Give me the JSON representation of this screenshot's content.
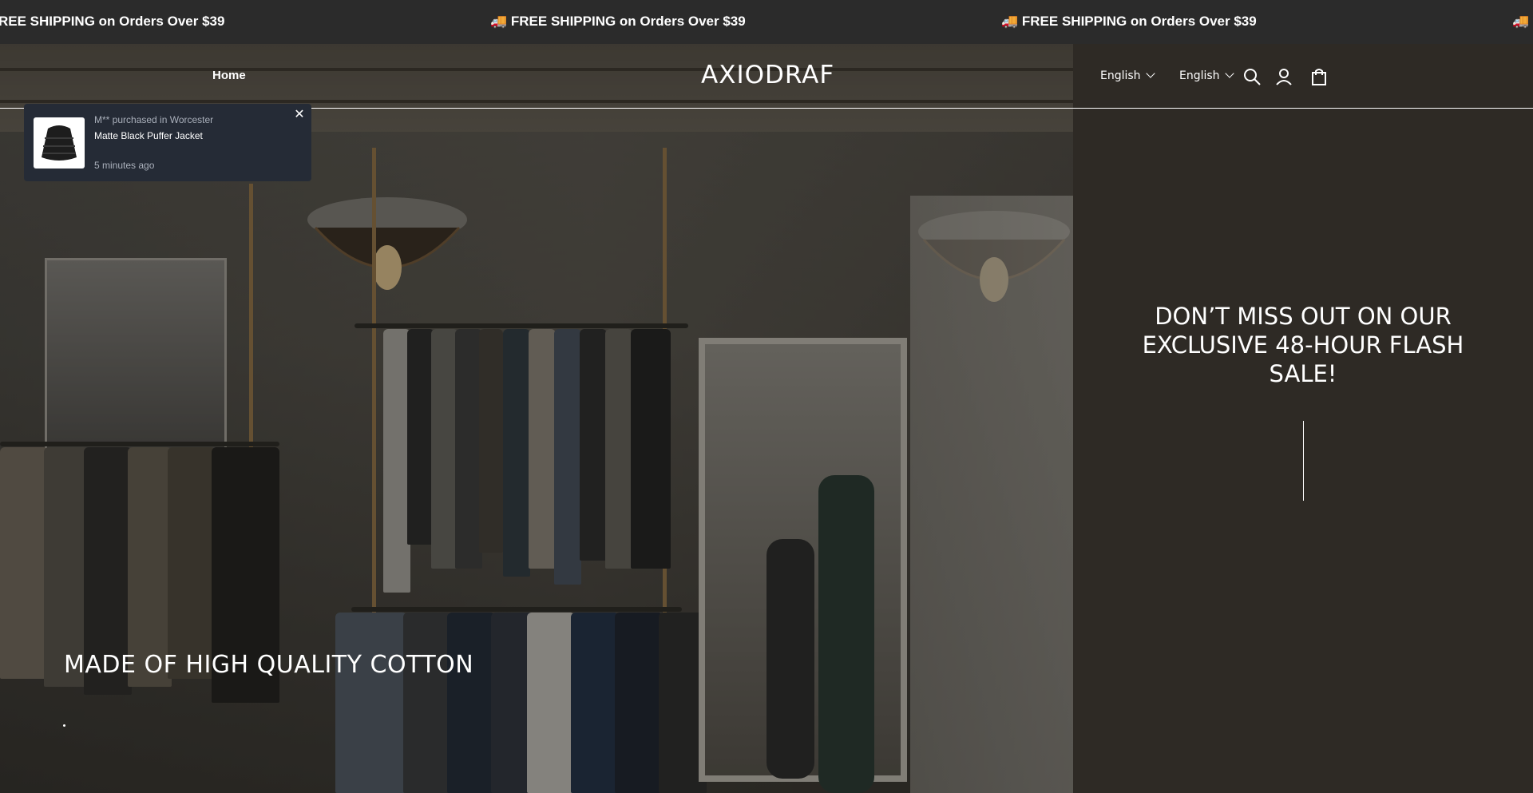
{
  "announcement": {
    "messages": [
      "REE SHIPPING on Orders Over $39",
      "🚚 FREE SHIPPING on Orders Over $39",
      "🚚 FREE SHIPPING on Orders Over $39",
      "🚚 FR"
    ]
  },
  "header": {
    "nav_home": "Home",
    "logo": "AXIODRAF",
    "language_1": "English",
    "language_2": "English",
    "icons": [
      "search-icon",
      "account-icon",
      "cart-icon"
    ]
  },
  "popup": {
    "line1": "M** purchased in Worcester",
    "line2": "Matte Black Puffer Jacket",
    "line3": "5 minutes ago",
    "close_icon": "close-icon"
  },
  "hero": {
    "caption": "MADE OF HIGH QUALITY COTTON"
  },
  "flash": {
    "heading": "DON’T MISS OUT ON OUR EXCLUSIVE 48-HOUR FLASH SALE!"
  },
  "colors": {
    "announcement_bg": "#2b2b2b",
    "side_panel_bg": "#2e2a25",
    "popup_bg": "#252b36",
    "text": "#ffffff"
  }
}
